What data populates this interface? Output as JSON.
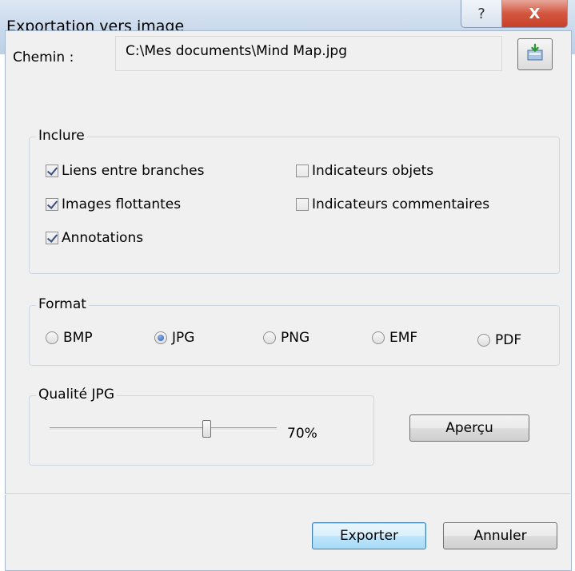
{
  "window": {
    "title": "Exportation vers image",
    "help_label": "?",
    "close_label": "X"
  },
  "path": {
    "label": "Chemin :",
    "value": "C:\\Mes documents\\Mind Map.jpg"
  },
  "include": {
    "label": "Inclure",
    "options": [
      {
        "label": "Liens entre branches",
        "checked": true
      },
      {
        "label": "Images flottantes",
        "checked": true
      },
      {
        "label": "Annotations",
        "checked": true
      },
      {
        "label": "Indicateurs objets",
        "checked": false
      },
      {
        "label": "Indicateurs commentaires",
        "checked": false
      }
    ]
  },
  "format": {
    "label": "Format",
    "options": [
      {
        "label": "BMP",
        "selected": false
      },
      {
        "label": "JPG",
        "selected": true
      },
      {
        "label": "PNG",
        "selected": false
      },
      {
        "label": "EMF",
        "selected": false
      },
      {
        "label": "PDF",
        "selected": false
      }
    ]
  },
  "quality": {
    "label": "Qualité JPG",
    "value": 70,
    "value_text": "70%",
    "preview_label": "Aperçu"
  },
  "footer": {
    "export_label": "Exporter",
    "cancel_label": "Annuler"
  },
  "icons": {
    "browse": "save-folder-icon"
  }
}
